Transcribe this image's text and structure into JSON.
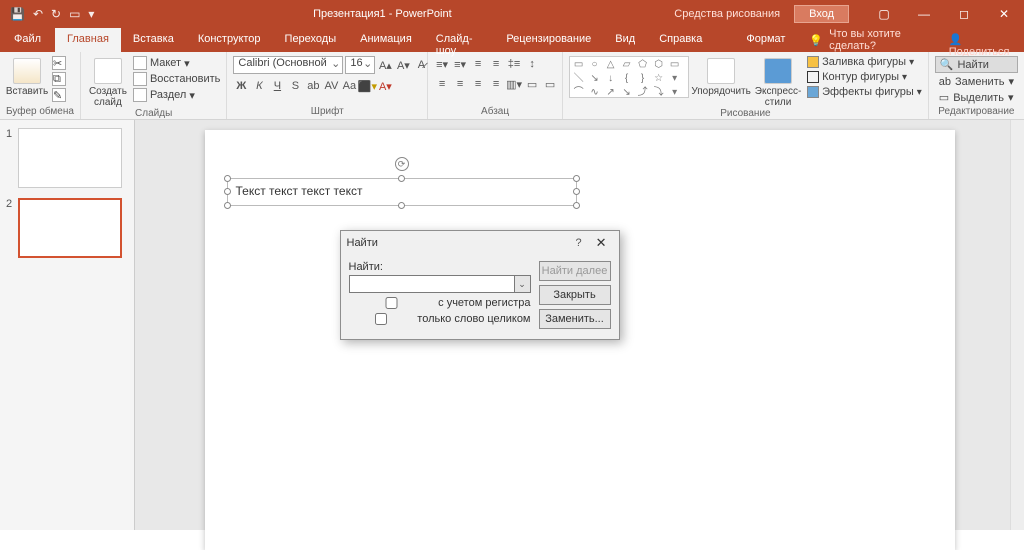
{
  "titlebar": {
    "doc": "Презентация1 - PowerPoint",
    "tools": "Средства рисования",
    "login": "Вход"
  },
  "menu": {
    "file": "Файл",
    "home": "Главная",
    "insert": "Вставка",
    "design": "Конструктор",
    "transitions": "Переходы",
    "animations": "Анимация",
    "slideshow": "Слайд-шоу",
    "review": "Рецензирование",
    "view": "Вид",
    "help": "Справка",
    "format": "Формат",
    "tell": "Что вы хотите сделать?",
    "share": "Поделиться"
  },
  "ribbon": {
    "clipboard": {
      "paste": "Вставить",
      "label": "Буфер обмена"
    },
    "slides": {
      "new": "Создать\nслайд",
      "layout": "Макет",
      "reset": "Восстановить",
      "section": "Раздел",
      "label": "Слайды"
    },
    "font": {
      "family": "Calibri (Основной",
      "size": "16",
      "label": "Шрифт"
    },
    "para": {
      "label": "Абзац"
    },
    "draw": {
      "arrange": "Упорядочить",
      "quick": "Экспресс-\nстили",
      "fill": "Заливка фигуры",
      "outline": "Контур фигуры",
      "effects": "Эффекты фигуры",
      "label": "Рисование"
    },
    "edit": {
      "find": "Найти",
      "replace": "Заменить",
      "select": "Выделить",
      "label": "Редактирование"
    }
  },
  "slidetext": "Текст текст текст текст",
  "dialog": {
    "title": "Найти",
    "findlabel": "Найти:",
    "case": "с учетом регистра",
    "whole": "только слово целиком",
    "findnext": "Найти далее",
    "close": "Закрыть",
    "replace": "Заменить..."
  }
}
